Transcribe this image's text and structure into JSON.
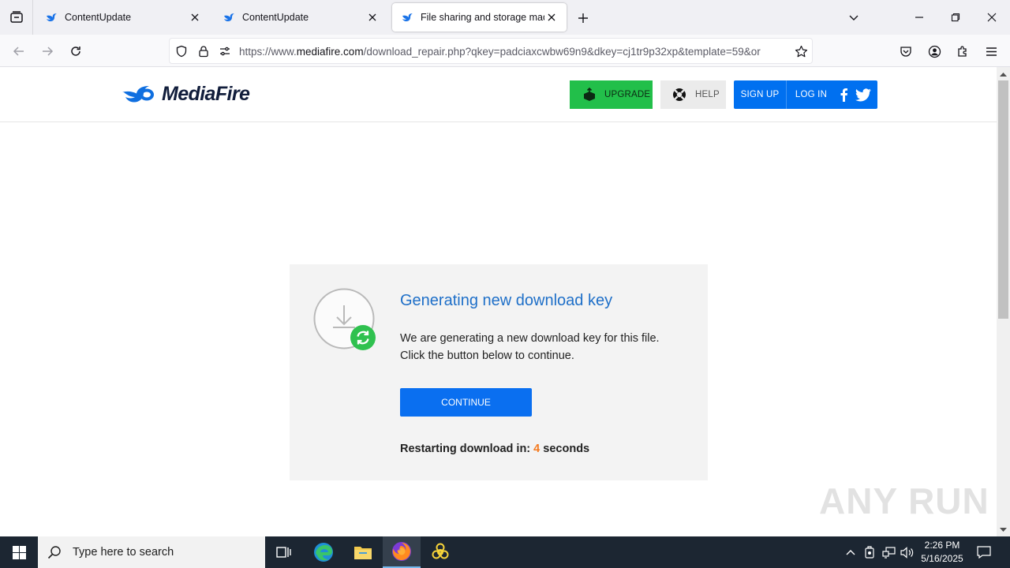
{
  "browser": {
    "tabs": [
      {
        "title": "ContentUpdate",
        "active": false
      },
      {
        "title": "ContentUpdate",
        "active": false
      },
      {
        "title": "File sharing and storage made",
        "active": true
      }
    ],
    "url": {
      "prefix": "https://www.",
      "host": "mediafire.com",
      "path": "/download_repair.php?qkey=padciaxcwbw69n9&dkey=cj1tr9p32xp&template=59&or"
    }
  },
  "site": {
    "logo_text": "MediaFire",
    "header": {
      "upgrade_label": "UPGRADE",
      "help_label": "HELP",
      "signup_label": "SIGN UP",
      "login_label": "LOG IN"
    },
    "card": {
      "title": "Generating new download key",
      "desc_line1": "We are generating a new download key for this file.",
      "desc_line2": "Click the button below to continue.",
      "continue_label": "CONTINUE",
      "restart_prefix": "Restarting download in:",
      "restart_count": "4",
      "restart_suffix": "seconds"
    },
    "watermark": "ANY RUN"
  },
  "taskbar": {
    "search_placeholder": "Type here to search",
    "clock_time": "2:26 PM",
    "clock_date": "5/16/2025"
  },
  "colors": {
    "brand_blue": "#0070f0",
    "upgrade_green": "#22bf4a",
    "title_blue": "#1e6fc8",
    "countdown_orange": "#f47a1f"
  }
}
